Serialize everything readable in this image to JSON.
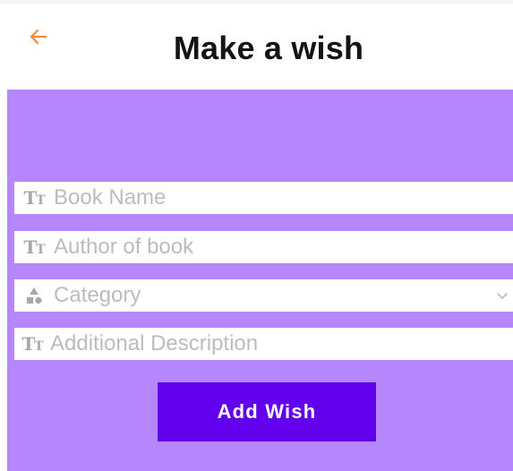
{
  "header": {
    "title": "Make a wish",
    "back_icon": "arrow-left-icon",
    "accent_color": "#f08a3c"
  },
  "form": {
    "background_color": "#b687fc",
    "fields": [
      {
        "icon": "text-format-icon",
        "placeholder": "Book Name"
      },
      {
        "icon": "text-format-icon",
        "placeholder": "Author of book"
      },
      {
        "icon": "category-shapes-icon",
        "placeholder": "Category",
        "dropdown_icon": "chevron-down-icon"
      },
      {
        "icon": "text-format-icon",
        "placeholder": "Additional Description"
      }
    ],
    "submit_label": "Add Wish",
    "submit_color": "#6200ee"
  }
}
